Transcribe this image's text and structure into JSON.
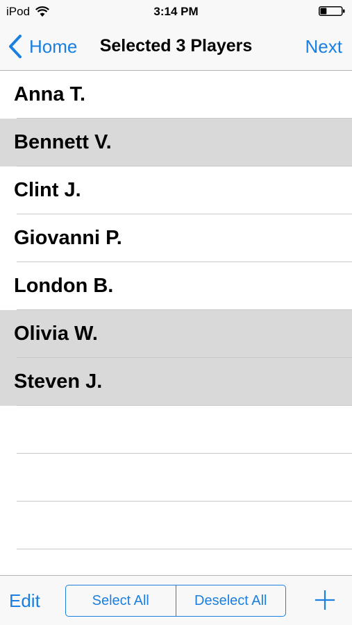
{
  "status_bar": {
    "carrier": "iPod",
    "time": "3:14 PM",
    "wifi_icon": "wifi-icon",
    "battery_icon": "battery-icon",
    "battery_level": 0.3
  },
  "nav": {
    "back_label": "Home",
    "title": "Selected 3 Players",
    "next_label": "Next",
    "back_icon": "chevron-left-icon"
  },
  "players": [
    {
      "name": "Anna T.",
      "selected": false
    },
    {
      "name": "Bennett V.",
      "selected": true
    },
    {
      "name": "Clint J.",
      "selected": false
    },
    {
      "name": "Giovanni P.",
      "selected": false
    },
    {
      "name": "London B.",
      "selected": false
    },
    {
      "name": "Olivia W.",
      "selected": true
    },
    {
      "name": "Steven J.",
      "selected": true
    },
    {
      "name": "",
      "selected": false
    },
    {
      "name": "",
      "selected": false
    },
    {
      "name": "",
      "selected": false
    }
  ],
  "toolbar": {
    "edit_label": "Edit",
    "select_all_label": "Select All",
    "deselect_all_label": "Deselect All",
    "add_icon": "plus-icon"
  },
  "colors": {
    "accent": "#1a7fe0",
    "selected_row": "#d9d9d9",
    "bar_background": "#f8f8f8"
  }
}
